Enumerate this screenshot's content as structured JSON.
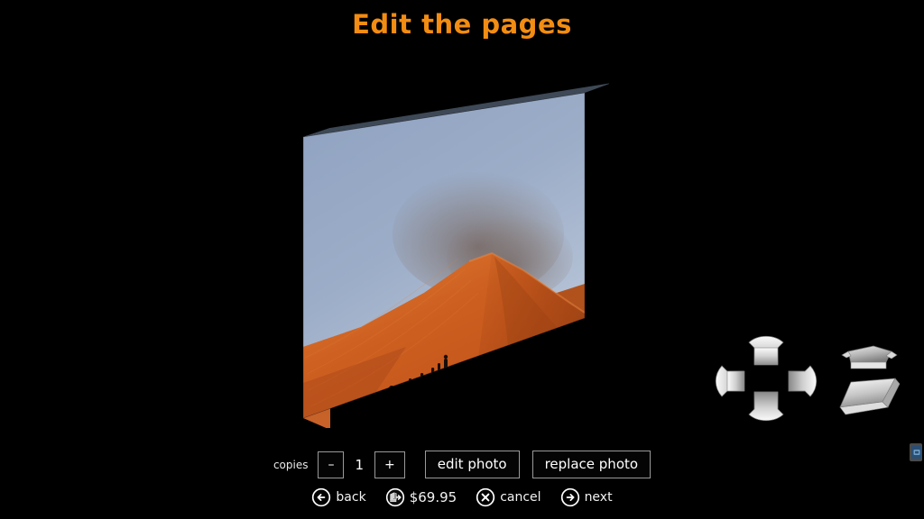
{
  "page": {
    "title": "Edit the pages",
    "background_color": "#000000",
    "title_color": "#f28c12"
  },
  "product": {
    "name": "canvas-print-preview",
    "type": "3d-canvas-wrap",
    "photo_description": "Desert sand dune at dawn with a line of people walking along the ridge",
    "colors": {
      "sky_top": "#93a6c3",
      "sky_bottom": "#b9c6da",
      "sand": "#cd5f20",
      "sand_light": "#e07a33",
      "edge_top": "#3b4552",
      "edge_left_sky": "#7d8eac",
      "edge_left_sand": "#b2561e",
      "figure": "#140a06"
    },
    "figure_count": 6
  },
  "nav": {
    "rotate_widget_label": "rotate-view",
    "page_widget_label": "flip-page",
    "colors": {
      "light": "#f2f2f2",
      "mid": "#b8b8b8",
      "dark": "#6e6e6e",
      "shadow": "#3a3a3a"
    }
  },
  "toolbar": {
    "copies_label": "copies",
    "decrement_label": "–",
    "copies_value": "1",
    "increment_label": "+",
    "edit_photo_label": "edit photo",
    "replace_photo_label": "replace photo"
  },
  "actionbar": {
    "back_label": "back",
    "price_label": "$69.95",
    "cancel_label": "cancel",
    "next_label": "next"
  }
}
